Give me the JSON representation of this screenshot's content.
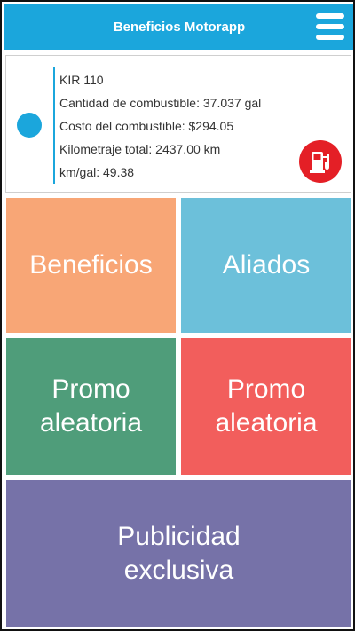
{
  "header": {
    "title": "Beneficios Motorapp",
    "menu_icon": "hamburger-menu-icon"
  },
  "vehicle": {
    "plate": "KIR 110",
    "fuel_amount": "Cantidad de combustible: 37.037 gal",
    "fuel_cost": "Costo del combustible: $294.05",
    "total_km": "Kilometraje total: 2437.00 km",
    "km_per_gal": "km/gal: 49.38",
    "fuel_icon": "fuel-pump-icon"
  },
  "tiles": {
    "beneficios": "Beneficios",
    "aliados": "Aliados",
    "promo_1": "Promo\naleatoria",
    "promo_2": "Promo\naleatoria",
    "publicidad": "Publicidad\nexclusiva"
  },
  "colors": {
    "header": "#1ba6dc",
    "beneficios": "#f8a676",
    "aliados": "#6cc0da",
    "promo_1": "#4f9d7a",
    "promo_2": "#f25e5c",
    "publicidad": "#7672a8",
    "fuel_button": "#e41f26"
  }
}
